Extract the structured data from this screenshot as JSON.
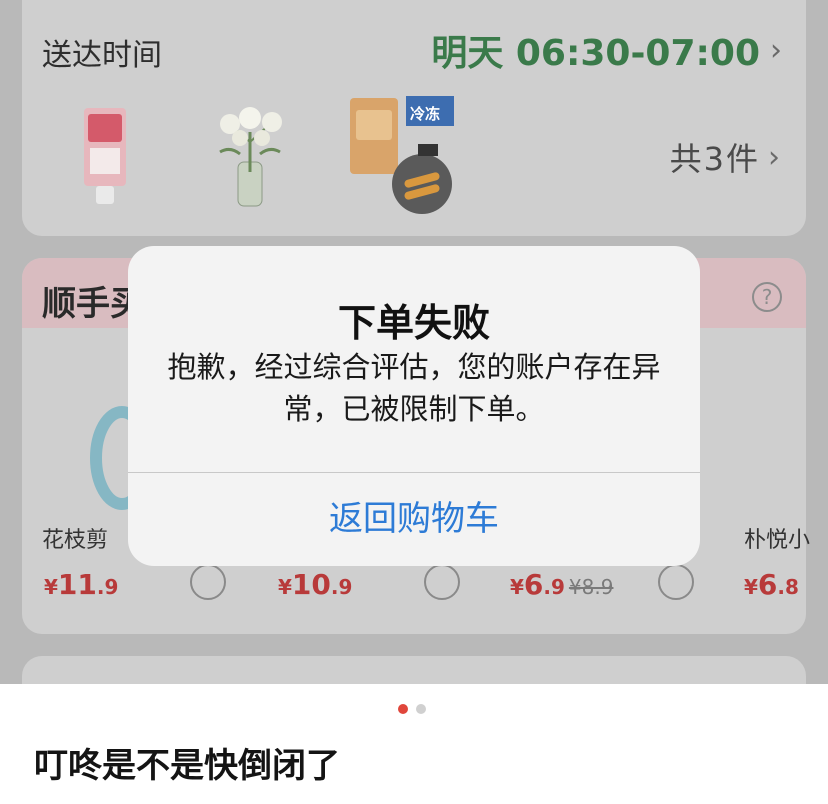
{
  "delivery": {
    "label": "送达时间",
    "time": "明天 06:30-07:00",
    "chevron": "›",
    "count": "共3件",
    "frozen_badge": "冷冻"
  },
  "addon": {
    "title": "顺手买",
    "help_icon": "question-circle-icon",
    "products": [
      {
        "name": "花枝剪",
        "price_symbol": "¥",
        "price_int": "11",
        "price_dec": ".9",
        "old_price": ""
      },
      {
        "name": "",
        "price_symbol": "¥",
        "price_int": "10",
        "price_dec": ".9",
        "old_price": ""
      },
      {
        "name": "",
        "price_symbol": "¥",
        "price_int": "6",
        "price_dec": ".9",
        "old_price": "¥8.9"
      },
      {
        "name": "朴悦小",
        "price_symbol": "¥",
        "price_int": "6",
        "price_dec": ".8",
        "old_price": ""
      }
    ]
  },
  "modal": {
    "title": "下单失败",
    "message": "抱歉，经过综合评估，您的账户存在异常，已被限制下单。",
    "button": "返回购物车"
  },
  "pager": {
    "active": 0,
    "total": 2
  },
  "caption": "叮咚是不是快倒闭了",
  "colors": {
    "time_green": "#3a7a4a",
    "price_red": "#b83a3a",
    "link_blue": "#2d7bd6",
    "dot_red": "#e0463b"
  }
}
